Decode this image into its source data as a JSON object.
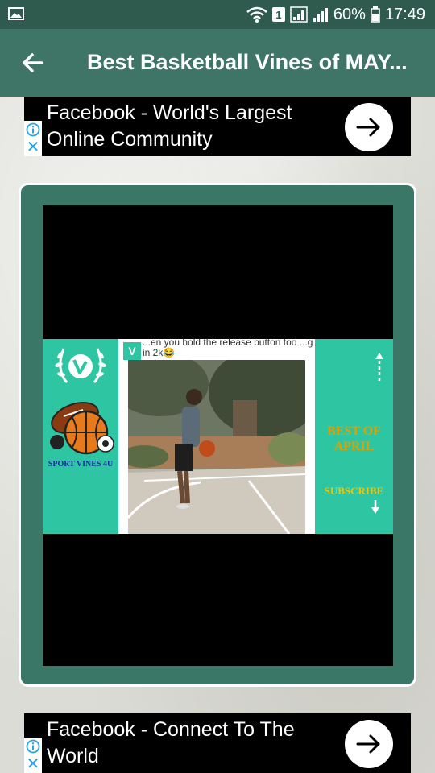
{
  "status_bar": {
    "battery": "60%",
    "time": "17:49",
    "sim_slot": "1"
  },
  "app_bar": {
    "title": "Best Basketball Vines of MAY..."
  },
  "ads": [
    {
      "text": "Facebook - World's Largest Online Community"
    },
    {
      "text": "Facebook - Connect To The World"
    }
  ],
  "video": {
    "caption": "...en you hold the release button too ...g in 2k😂",
    "left_badge": "SPORT VINES 4U",
    "right_title": "BEST OF APRIL",
    "subscribe": "SUBSCRIBE"
  },
  "icons": {
    "back": "arrow-left-icon",
    "ad_go": "arrow-right-icon",
    "ad_info": "info-icon",
    "ad_close": "close-icon"
  },
  "colors": {
    "status_bar": "#2f5a4e",
    "app_bar": "#3e7566",
    "card": "#3b7766",
    "teal_panel": "#2ec6a2",
    "gold": "#e0a000"
  }
}
